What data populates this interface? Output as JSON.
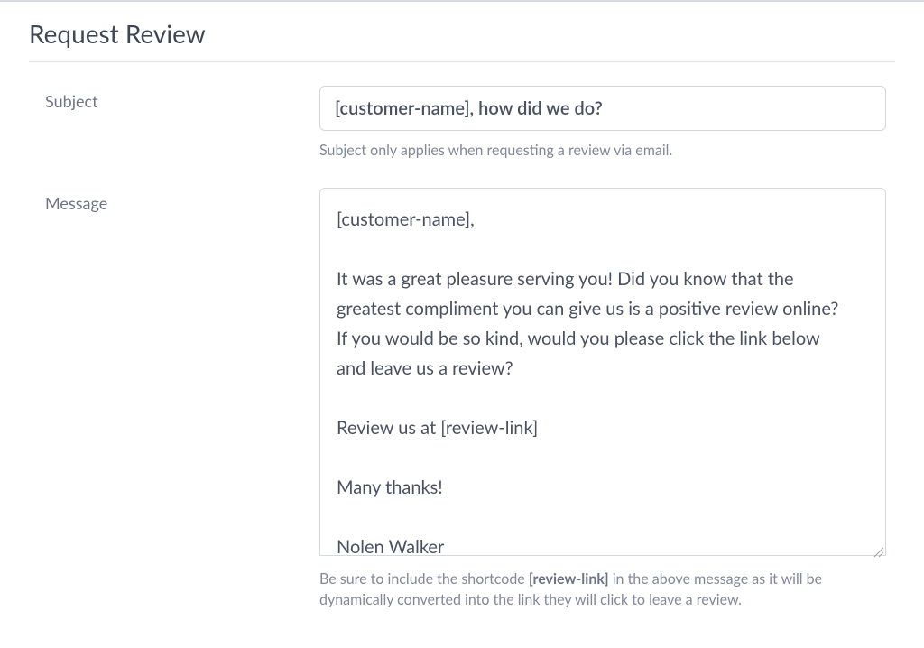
{
  "page": {
    "title": "Request Review"
  },
  "form": {
    "subject": {
      "label": "Subject",
      "value": "[customer-name], how did we do?",
      "help": "Subject only applies when requesting a review via email."
    },
    "message": {
      "label": "Message",
      "value": "[customer-name],\n\nIt was a great pleasure serving you! Did you know that the greatest compliment you can give us is a positive review online? If you would be so kind, would you please click the link below and leave us a review?\n\nReview us at [review-link]\n\nMany thanks!\n\nNolen Walker",
      "help_pre": "Be sure to include the shortcode ",
      "help_strong": "[review-link]",
      "help_post": " in the above message as it will be dynamically converted into the link they will click to leave a review."
    }
  }
}
